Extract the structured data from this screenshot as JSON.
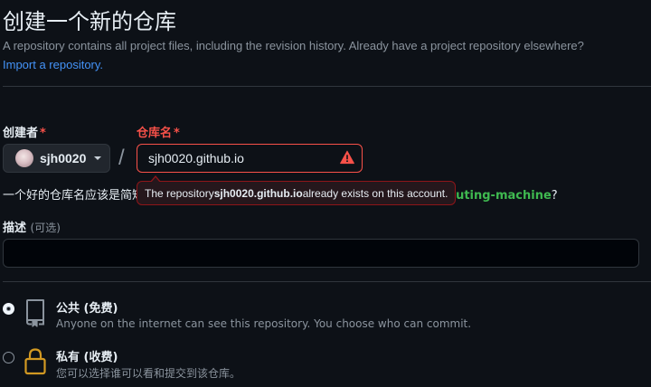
{
  "header": {
    "title": "创建一个新的仓库",
    "subtitle": "A repository contains all project files, including the revision history. Already have a project repository elsewhere?",
    "import_link": "Import a repository."
  },
  "owner": {
    "label": "创建者",
    "required_mark": "*",
    "name": "sjh0020"
  },
  "separator": "/",
  "repo": {
    "label": "仓库名",
    "required_mark": "*",
    "value": "sjh0020.github.io",
    "error_state": true
  },
  "hint": {
    "prefix": "一个好的仓库名应该是简短而令人难忘的。需要灵感吗？",
    "suggestion": "fuzzy-octo-human-computing-machine",
    "suffix": "?"
  },
  "tooltip": {
    "before": "The repository ",
    "repo_name": "sjh0020.github.io",
    "after": " already exists on this account."
  },
  "description": {
    "label": "描述",
    "optional": "(可选)",
    "value": ""
  },
  "visibility": {
    "public": {
      "title": "公共 (免费)",
      "desc": "Anyone on the internet can see this repository. You choose who can commit.",
      "selected": true
    },
    "private": {
      "title": "私有 (收费)",
      "desc": "您可以选择谁可以看和提交到该仓库。",
      "selected": false
    }
  },
  "colors": {
    "background": "#0d1117",
    "error": "#f85149",
    "link": "#4493f8",
    "suggestion": "#3fb950",
    "warning_icon": "#f85149"
  },
  "icons": {
    "warning": "alert-triangle-icon",
    "public_repo": "repo-icon",
    "private_repo": "lock-icon",
    "caret": "triangle-down-icon"
  }
}
